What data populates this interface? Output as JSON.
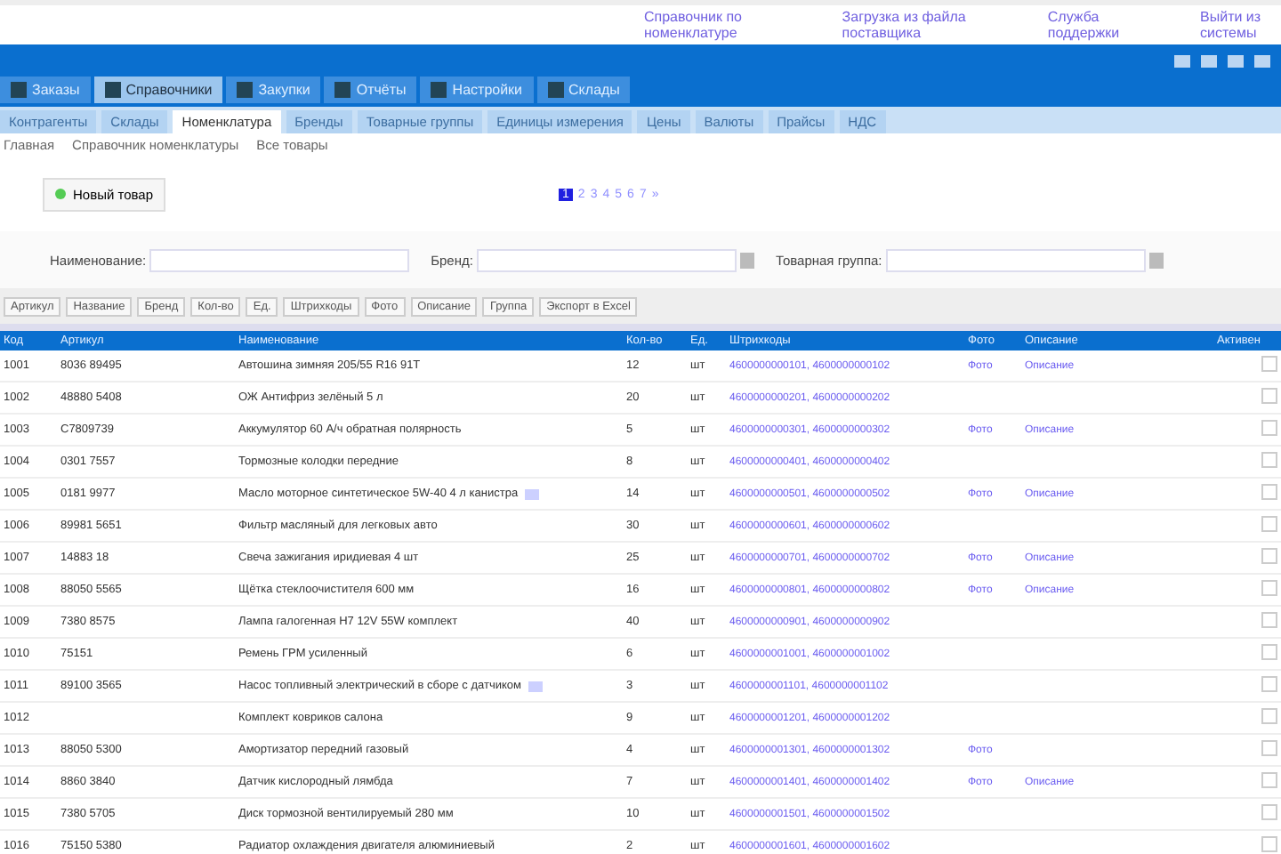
{
  "top_links": [
    "Справочник по номенклатуре",
    "Загрузка из файла поставщика",
    "Служба поддержки",
    "Выйти из системы"
  ],
  "main_tabs": [
    {
      "label": "Заказы",
      "selected": false
    },
    {
      "label": "Справочники",
      "selected": true
    },
    {
      "label": "Закупки",
      "selected": false
    },
    {
      "label": "Отчёты",
      "selected": false
    },
    {
      "label": "Настройки",
      "selected": false
    },
    {
      "label": "Склады",
      "selected": false
    }
  ],
  "sub_tabs": [
    {
      "label": "Контрагенты",
      "selected": false
    },
    {
      "label": "Склады",
      "selected": false
    },
    {
      "label": "Номенклатура",
      "selected": true
    },
    {
      "label": "Бренды",
      "selected": false
    },
    {
      "label": "Товарные группы",
      "selected": false
    },
    {
      "label": "Единицы измерения",
      "selected": false
    },
    {
      "label": "Цены",
      "selected": false
    },
    {
      "label": "Валюты",
      "selected": false
    },
    {
      "label": "Прайсы",
      "selected": false
    },
    {
      "label": "НДС",
      "selected": false
    }
  ],
  "breadcrumbs": [
    "Главная",
    "Справочник номенклатуры",
    "Все товары"
  ],
  "new_button": "Новый товар",
  "pages": [
    {
      "label": "1",
      "selected": true
    },
    {
      "label": "2",
      "selected": false
    },
    {
      "label": "3",
      "selected": false
    },
    {
      "label": "4",
      "selected": false
    },
    {
      "label": "5",
      "selected": false
    },
    {
      "label": "6",
      "selected": false
    },
    {
      "label": "7",
      "selected": false
    },
    {
      "label": "»",
      "selected": false
    }
  ],
  "filters": [
    {
      "label": "Наименование:",
      "dropdown": false
    },
    {
      "label": "Бренд:",
      "dropdown": true
    },
    {
      "label": "Товарная группа:",
      "dropdown": true
    }
  ],
  "column_buttons": [
    "Артикул",
    "Название",
    "Бренд",
    "Кол-во",
    "Ед.",
    "Штрихкоды",
    "Фото",
    "Описание",
    "Группа",
    "Экспорт в Excel"
  ],
  "table": {
    "columns": [
      "Код",
      "Артикул",
      "Наименование",
      "Кол-во",
      "Ед.",
      "Штрихкоды",
      "Фото",
      "Описание",
      "Активен"
    ],
    "rows": [
      {
        "code": "1001",
        "article": "8036 89495",
        "name": "Автошина зимняя 205/55 R16 91T",
        "qty": "12",
        "unit": "шт",
        "barcode": "4600000000101, 4600000000102",
        "photo": "Фото",
        "desc": "Описание",
        "more": false,
        "active": false
      },
      {
        "code": "1002",
        "article": "48880 5408",
        "name": "ОЖ Антифриз зелёный 5 л",
        "qty": "20",
        "unit": "шт",
        "barcode": "4600000000201, 4600000000202",
        "more": false,
        "active": false
      },
      {
        "code": "1003",
        "article": "C7809739",
        "name": "Аккумулятор 60 А/ч обратная полярность",
        "qty": "5",
        "unit": "шт",
        "barcode": "4600000000301, 4600000000302",
        "photo": "Фото",
        "desc": "Описание",
        "more": false,
        "active": false
      },
      {
        "code": "1004",
        "article": "0301 7557",
        "name": "Тормозные колодки передние",
        "qty": "8",
        "unit": "шт",
        "barcode": "4600000000401, 4600000000402",
        "more": false,
        "active": false
      },
      {
        "code": "1005",
        "article": "0181 9977",
        "name": "Масло моторное синтетическое 5W-40 4 л канистра",
        "qty": "14",
        "unit": "шт",
        "barcode": "4600000000501, 4600000000502",
        "photo": "Фото",
        "desc": "Описание",
        "more": true,
        "active": false
      },
      {
        "code": "1006",
        "article": "89981 5651",
        "name": "Фильтр масляный для легковых авто",
        "qty": "30",
        "unit": "шт",
        "barcode": "4600000000601, 4600000000602",
        "more": false,
        "active": false
      },
      {
        "code": "1007",
        "article": "14883 18",
        "name": "Свеча зажигания иридиевая 4 шт",
        "qty": "25",
        "unit": "шт",
        "barcode": "4600000000701, 4600000000702",
        "photo": "Фото",
        "desc": "Описание",
        "more": false,
        "active": false
      },
      {
        "code": "1008",
        "article": "88050 5565",
        "name": "Щётка стеклоочистителя 600 мм",
        "qty": "16",
        "unit": "шт",
        "barcode": "4600000000801, 4600000000802",
        "photo": "Фото",
        "desc": "Описание",
        "more": false,
        "active": false
      },
      {
        "code": "1009",
        "article": "7380 8575",
        "name": "Лампа галогенная H7 12V 55W комплект",
        "qty": "40",
        "unit": "шт",
        "barcode": "4600000000901, 4600000000902",
        "more": false,
        "active": false
      },
      {
        "code": "1010",
        "article": "75151",
        "name": "Ремень ГРМ усиленный",
        "qty": "6",
        "unit": "шт",
        "barcode": "4600000001001, 4600000001002",
        "more": false,
        "active": false
      },
      {
        "code": "1011",
        "article": "89100 3565",
        "name": "Насос топливный электрический в сборе с датчиком",
        "qty": "3",
        "unit": "шт",
        "barcode": "4600000001101, 4600000001102",
        "more": true,
        "active": false
      },
      {
        "code": "1012",
        "name": "Комплект ковриков салона",
        "qty": "9",
        "unit": "шт",
        "barcode": "4600000001201, 4600000001202",
        "more": false,
        "active": false
      },
      {
        "code": "1013",
        "article": "88050 5300",
        "name": "Амортизатор передний газовый",
        "qty": "4",
        "unit": "шт",
        "barcode": "4600000001301, 4600000001302",
        "photo": "Фото",
        "more": false,
        "active": false
      },
      {
        "code": "1014",
        "article": "8860 3840",
        "name": "Датчик кислородный лямбда",
        "qty": "7",
        "unit": "шт",
        "barcode": "4600000001401, 4600000001402",
        "photo": "Фото",
        "desc": "Описание",
        "more": false,
        "active": false
      },
      {
        "code": "1015",
        "article": "7380 5705",
        "name": "Диск тормозной вентилируемый 280 мм",
        "qty": "10",
        "unit": "шт",
        "barcode": "4600000001501, 4600000001502",
        "more": false,
        "active": false
      },
      {
        "code": "1016",
        "article": "75150 5380",
        "name": "Радиатор охлаждения двигателя алюминиевый",
        "qty": "2",
        "unit": "шт",
        "barcode": "4600000001601, 4600000001602",
        "more": false,
        "active": false
      }
    ]
  }
}
